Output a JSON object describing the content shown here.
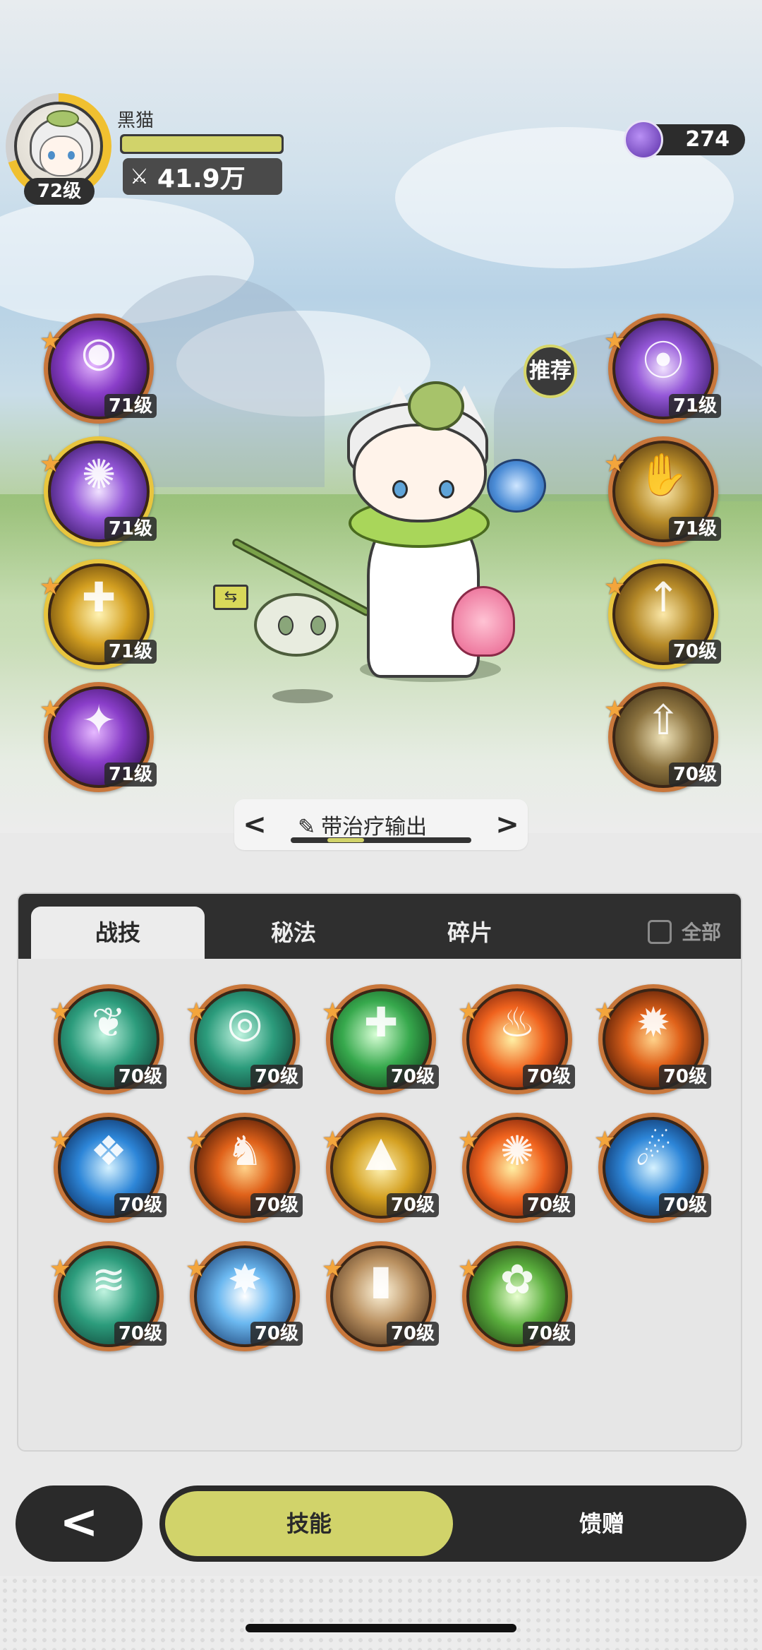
{
  "player": {
    "name": "黑猫",
    "level": "72级",
    "power": "41.9万"
  },
  "currency": {
    "value": "274",
    "icon": "purple-gem-icon"
  },
  "recommend_label": "推荐",
  "left_skills": [
    {
      "level": "71级",
      "style": "purple",
      "glyph": "◉",
      "icon": "purple-eye-skill-icon"
    },
    {
      "level": "71级",
      "style": "violet",
      "glyph": "✺",
      "icon": "violet-orb-skill-icon"
    },
    {
      "level": "71级",
      "style": "goldfx",
      "glyph": "✚",
      "icon": "gold-cross-skill-icon"
    },
    {
      "level": "71级",
      "style": "purple",
      "glyph": "✦",
      "icon": "purple-star-skill-icon"
    }
  ],
  "right_skills": [
    {
      "level": "71级",
      "style": "violet",
      "glyph": "⦿",
      "icon": "purple-sigil-skill-icon"
    },
    {
      "level": "71级",
      "style": "amber",
      "glyph": "✋",
      "icon": "gold-hand-skill-icon"
    },
    {
      "level": "70级",
      "style": "amber",
      "glyph": "↑",
      "icon": "gold-rise-skill-icon"
    },
    {
      "level": "70级",
      "style": "dullgold",
      "glyph": "⇧",
      "icon": "heal-arrow-skill-icon"
    }
  ],
  "build": {
    "label": "带治疗输出",
    "prev": "<",
    "next": ">"
  },
  "tabs": [
    {
      "label": "战技"
    },
    {
      "label": "秘法"
    },
    {
      "label": "碎片"
    }
  ],
  "filter_label": "全部",
  "grid_skills": [
    {
      "level": "70级",
      "style": "teal",
      "glyph": "❦",
      "icon": "thorn-vine-skill-icon"
    },
    {
      "level": "70级",
      "style": "teal",
      "glyph": "◎",
      "icon": "water-swirl-skill-icon"
    },
    {
      "level": "70级",
      "style": "green",
      "glyph": "✚",
      "icon": "green-heal-skill-icon"
    },
    {
      "level": "70级",
      "style": "fire",
      "glyph": "♨",
      "icon": "flame-skill-icon"
    },
    {
      "level": "70级",
      "style": "ember",
      "glyph": "✹",
      "icon": "fire-burst-skill-icon"
    },
    {
      "level": "70级",
      "style": "ice",
      "glyph": "❖",
      "icon": "ice-crystal-skill-icon"
    },
    {
      "level": "70级",
      "style": "ember",
      "glyph": "♞",
      "icon": "fire-wolf-skill-icon"
    },
    {
      "level": "70级",
      "style": "goldfx",
      "glyph": "▲",
      "icon": "gold-triangle-skill-icon"
    },
    {
      "level": "70级",
      "style": "fire",
      "glyph": "✺",
      "icon": "fire-orb-skill-icon"
    },
    {
      "level": "70级",
      "style": "ice",
      "glyph": "☄",
      "icon": "blue-flame-skill-icon"
    },
    {
      "level": "70级",
      "style": "teal",
      "glyph": "≋",
      "icon": "wind-slash-skill-icon"
    },
    {
      "level": "70级",
      "style": "icewhite",
      "glyph": "✸",
      "icon": "ice-burst-skill-icon"
    },
    {
      "level": "70级",
      "style": "sand",
      "glyph": "▮",
      "icon": "stone-card-skill-icon"
    },
    {
      "level": "70级",
      "style": "forest",
      "glyph": "✿",
      "icon": "forest-talisman-skill-icon"
    }
  ],
  "bottom_nav": {
    "back": "<",
    "active": "技能",
    "other": "馈赠"
  }
}
